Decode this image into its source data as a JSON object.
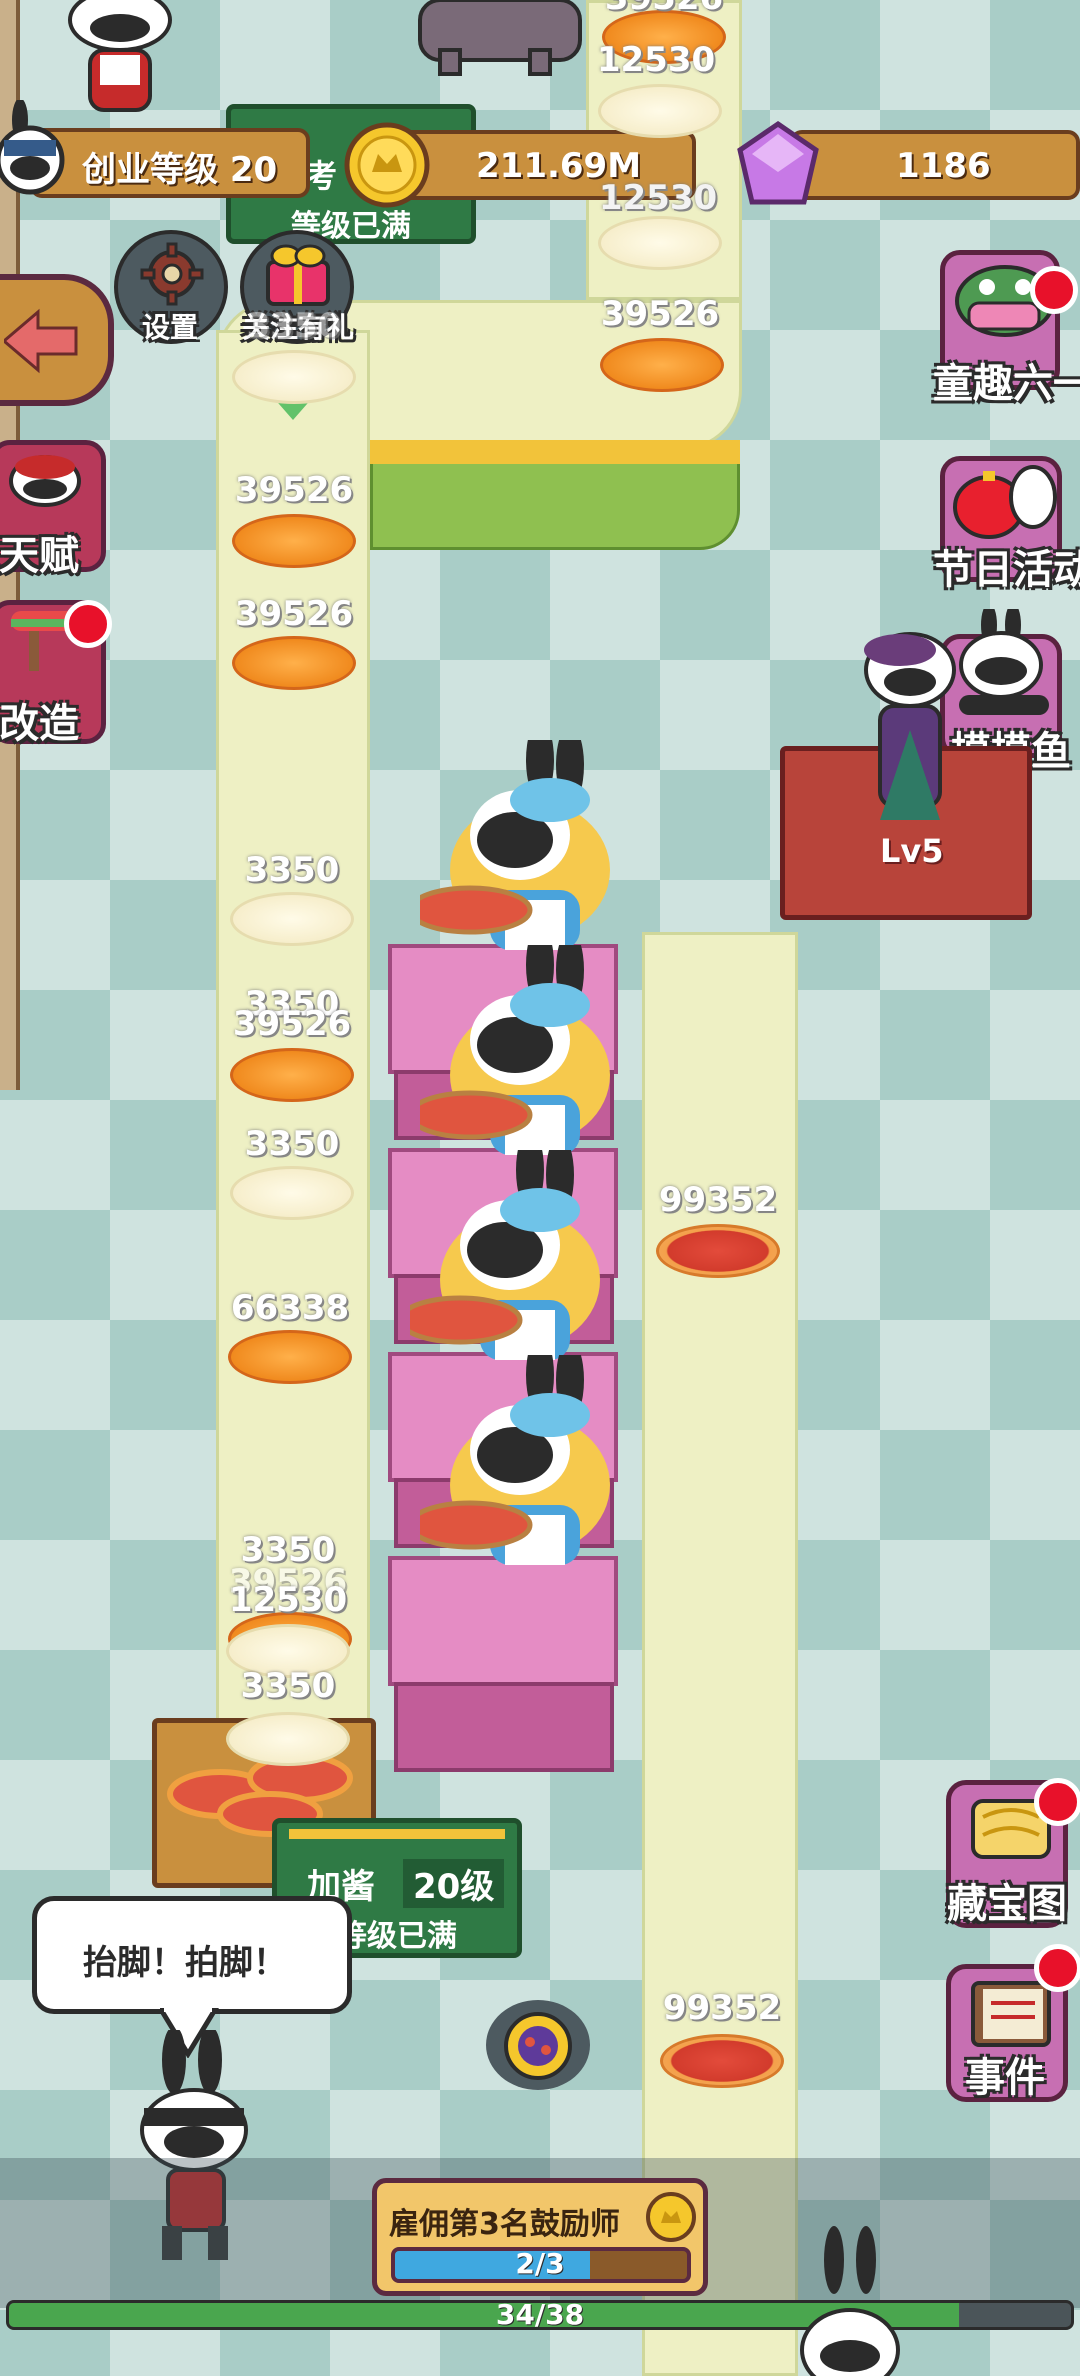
{
  "hud": {
    "level_label": "创业等级 20",
    "coins": "211.69M",
    "gems": "1186"
  },
  "top_buttons": {
    "settings": "设置",
    "follow_gift": "关注有礼"
  },
  "left_menu": {
    "talent": "天赋",
    "upgrade": "改造"
  },
  "right_menu": {
    "childrens_day": "童趣六一",
    "festival": "节日活动",
    "slack_off": "摸摸鱼",
    "treasure_map": "藏宝图",
    "events": "事件"
  },
  "stations": {
    "top_station_line1": "考",
    "top_station_line2": "等级已满",
    "sauce_station_title": "加酱",
    "sauce_station_level": "20级",
    "sauce_station_status": "等级已满",
    "manager_level": "Lv5"
  },
  "speech": "抬脚！拍脚！",
  "hire": {
    "title": "雇佣第3名鼓励师",
    "progress_text": "2/3",
    "progress": 0.667
  },
  "overall_progress": {
    "text": "34/38",
    "progress": 0.895
  },
  "food_labels": {
    "t1": "39526",
    "t2": "12530",
    "t3": "12530",
    "t4": "39526",
    "t5": "3350",
    "l1": "39526",
    "l2": "39526",
    "l3": "3350",
    "l4": "3350",
    "l5": "39526",
    "l6": "3350",
    "l7": "66338",
    "l8": "3350",
    "l9": "39526",
    "l10": "12530",
    "l11": "3350",
    "r1": "99352",
    "r2": "99352"
  },
  "colors": {
    "belt": "#eef0c4",
    "station_green": "#2f7a45",
    "wood": "#c9903e",
    "table_pink": "#e58cc4",
    "progress_blue": "#3fa8e0",
    "progress_green": "#4aa64e"
  }
}
